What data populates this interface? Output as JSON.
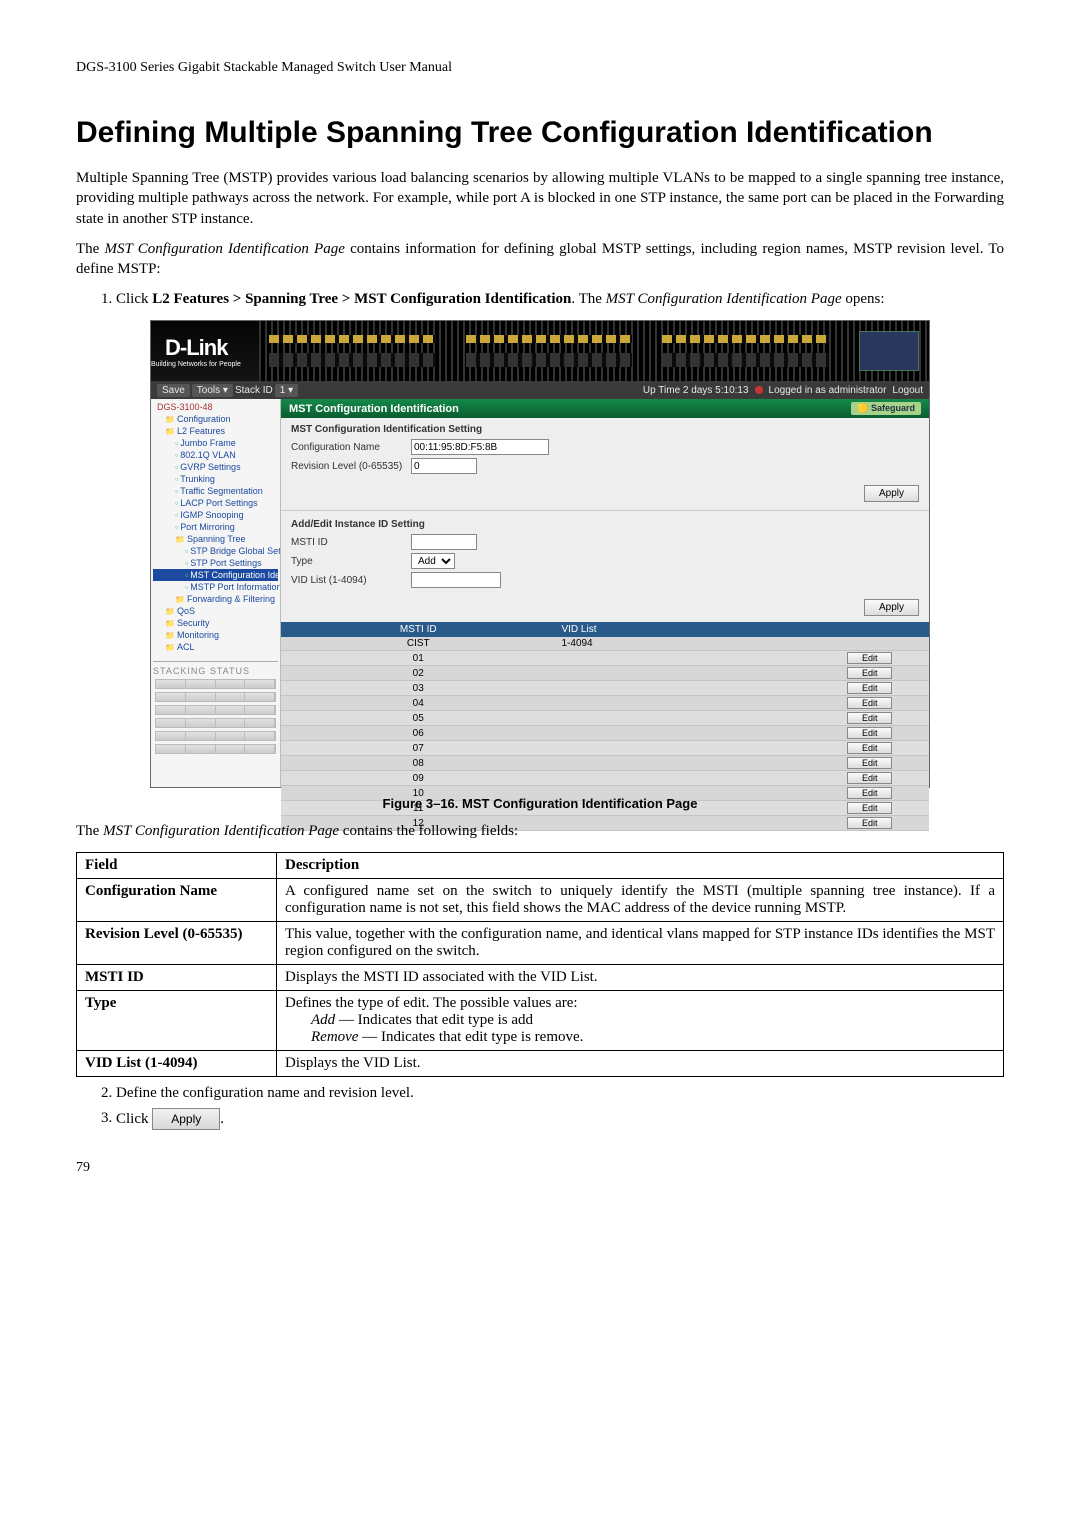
{
  "doc_header": "DGS-3100 Series Gigabit Stackable Managed Switch User Manual",
  "section_title": "Defining Multiple Spanning Tree Configuration Identification",
  "para1": "Multiple Spanning Tree (MSTP) provides various load balancing scenarios by allowing multiple VLANs to be mapped to a single spanning tree instance, providing multiple pathways across the network. For example, while port A is blocked in one STP instance, the same port can be placed in the Forwarding state in another STP instance.",
  "para2_pre": "The ",
  "para2_em": "MST Configuration Identification Page",
  "para2_post": " contains information for defining global MSTP settings, including region names, MSTP revision level. To define MSTP:",
  "step1_pre": "Click ",
  "step1_bold": "L2 Features > Spanning Tree > MST Configuration Identification",
  "step1_mid": ". The ",
  "step1_em": "MST Configuration Identification Page",
  "step1_post": " opens:",
  "figure_caption": "Figure 3–16. MST Configuration Identification Page",
  "para3_pre": "The ",
  "para3_em": "MST Configuration Identification Page",
  "para3_post": " contains the following fields:",
  "table_head_field": "Field",
  "table_head_desc": "Description",
  "fields": [
    {
      "name": "Configuration Name",
      "desc": "A configured name set on the switch to uniquely identify the MSTI (multiple spanning tree instance). If a configuration name is not set, this field shows the MAC address of the device running MSTP."
    },
    {
      "name": "Revision Level (0-65535)",
      "desc": "This value, together with the configuration name, and identical vlans mapped for STP instance IDs  identifies the MST region configured on the switch."
    },
    {
      "name": "MSTI ID",
      "desc": "Displays the MSTI ID associated with the VID List."
    },
    {
      "name": "Type",
      "desc_lines": [
        {
          "text": "Defines the type of edit. The possible values are:"
        },
        {
          "em": "Add",
          "text": " — Indicates that edit type is add"
        },
        {
          "em": "Remove",
          "text": " — Indicates that edit type is remove."
        }
      ]
    },
    {
      "name": "VID List (1-4094)",
      "desc": "Displays the VID List."
    }
  ],
  "step2": "Define the configuration name and revision level.",
  "step3_pre": "Click ",
  "step3_btn": "Apply",
  "step3_post": ".",
  "page_number": "79",
  "app": {
    "brand": "D-Link",
    "brand_sub": "Building Networks for People",
    "toolbar": {
      "save": "Save",
      "tools": "Tools ▾",
      "stack_id_label": "Stack ID",
      "stack_id_value": "1 ▾",
      "uptime": "Up Time 2 days 5:10:13",
      "logged_in": "Logged in as administrator",
      "logout": "Logout"
    },
    "tree_root": "DGS-3100-48",
    "tree": [
      {
        "label": "Configuration",
        "lev": 1,
        "t": "folder"
      },
      {
        "label": "L2 Features",
        "lev": 1,
        "t": "folder"
      },
      {
        "label": "Jumbo Frame",
        "lev": 2,
        "t": "doc"
      },
      {
        "label": "802.1Q VLAN",
        "lev": 2,
        "t": "doc"
      },
      {
        "label": "GVRP Settings",
        "lev": 2,
        "t": "doc"
      },
      {
        "label": "Trunking",
        "lev": 2,
        "t": "doc"
      },
      {
        "label": "Traffic Segmentation",
        "lev": 2,
        "t": "doc"
      },
      {
        "label": "LACP Port Settings",
        "lev": 2,
        "t": "doc"
      },
      {
        "label": "IGMP Snooping",
        "lev": 2,
        "t": "doc"
      },
      {
        "label": "Port Mirroring",
        "lev": 2,
        "t": "doc"
      },
      {
        "label": "Spanning Tree",
        "lev": 2,
        "t": "folder"
      },
      {
        "label": "STP Bridge Global Settin",
        "lev": 3,
        "t": "doc"
      },
      {
        "label": "STP Port Settings",
        "lev": 3,
        "t": "doc"
      },
      {
        "label": "MST Configuration Ident",
        "lev": 3,
        "t": "doc",
        "sel": true
      },
      {
        "label": "MSTP Port Information",
        "lev": 3,
        "t": "doc"
      },
      {
        "label": "Forwarding & Filtering",
        "lev": 2,
        "t": "folder"
      },
      {
        "label": "QoS",
        "lev": 1,
        "t": "folder"
      },
      {
        "label": "Security",
        "lev": 1,
        "t": "folder"
      },
      {
        "label": "Monitoring",
        "lev": 1,
        "t": "folder"
      },
      {
        "label": "ACL",
        "lev": 1,
        "t": "folder"
      }
    ],
    "stacking_status": "STACKING STATUS",
    "page_title": "MST Configuration Identification",
    "safeguard": "Safeguard",
    "section1_hdr": "MST Configuration Identification Setting",
    "form": {
      "cfg_name_label": "Configuration Name",
      "cfg_name_value": "00:11:95:8D:F5:8B",
      "rev_label": "Revision Level (0-65535)",
      "rev_value": "0"
    },
    "section2_hdr": "Add/Edit Instance ID Setting",
    "form2": {
      "msti_label": "MSTI ID",
      "msti_value": "",
      "type_label": "Type",
      "type_value": "Add",
      "vid_label": "VID List (1-4094)",
      "vid_value": ""
    },
    "apply_label": "Apply",
    "grid_head_msti": "MSTI ID",
    "grid_head_vid": "VID List",
    "grid_cist_row": {
      "id": "CIST",
      "vid": "1-4094"
    },
    "grid_rows": [
      {
        "id": "01",
        "vid": ""
      },
      {
        "id": "02",
        "vid": ""
      },
      {
        "id": "03",
        "vid": ""
      },
      {
        "id": "04",
        "vid": ""
      },
      {
        "id": "05",
        "vid": ""
      },
      {
        "id": "06",
        "vid": ""
      },
      {
        "id": "07",
        "vid": ""
      },
      {
        "id": "08",
        "vid": ""
      },
      {
        "id": "09",
        "vid": ""
      },
      {
        "id": "10",
        "vid": ""
      },
      {
        "id": "11",
        "vid": ""
      },
      {
        "id": "12",
        "vid": ""
      }
    ],
    "edit_label": "Edit"
  }
}
